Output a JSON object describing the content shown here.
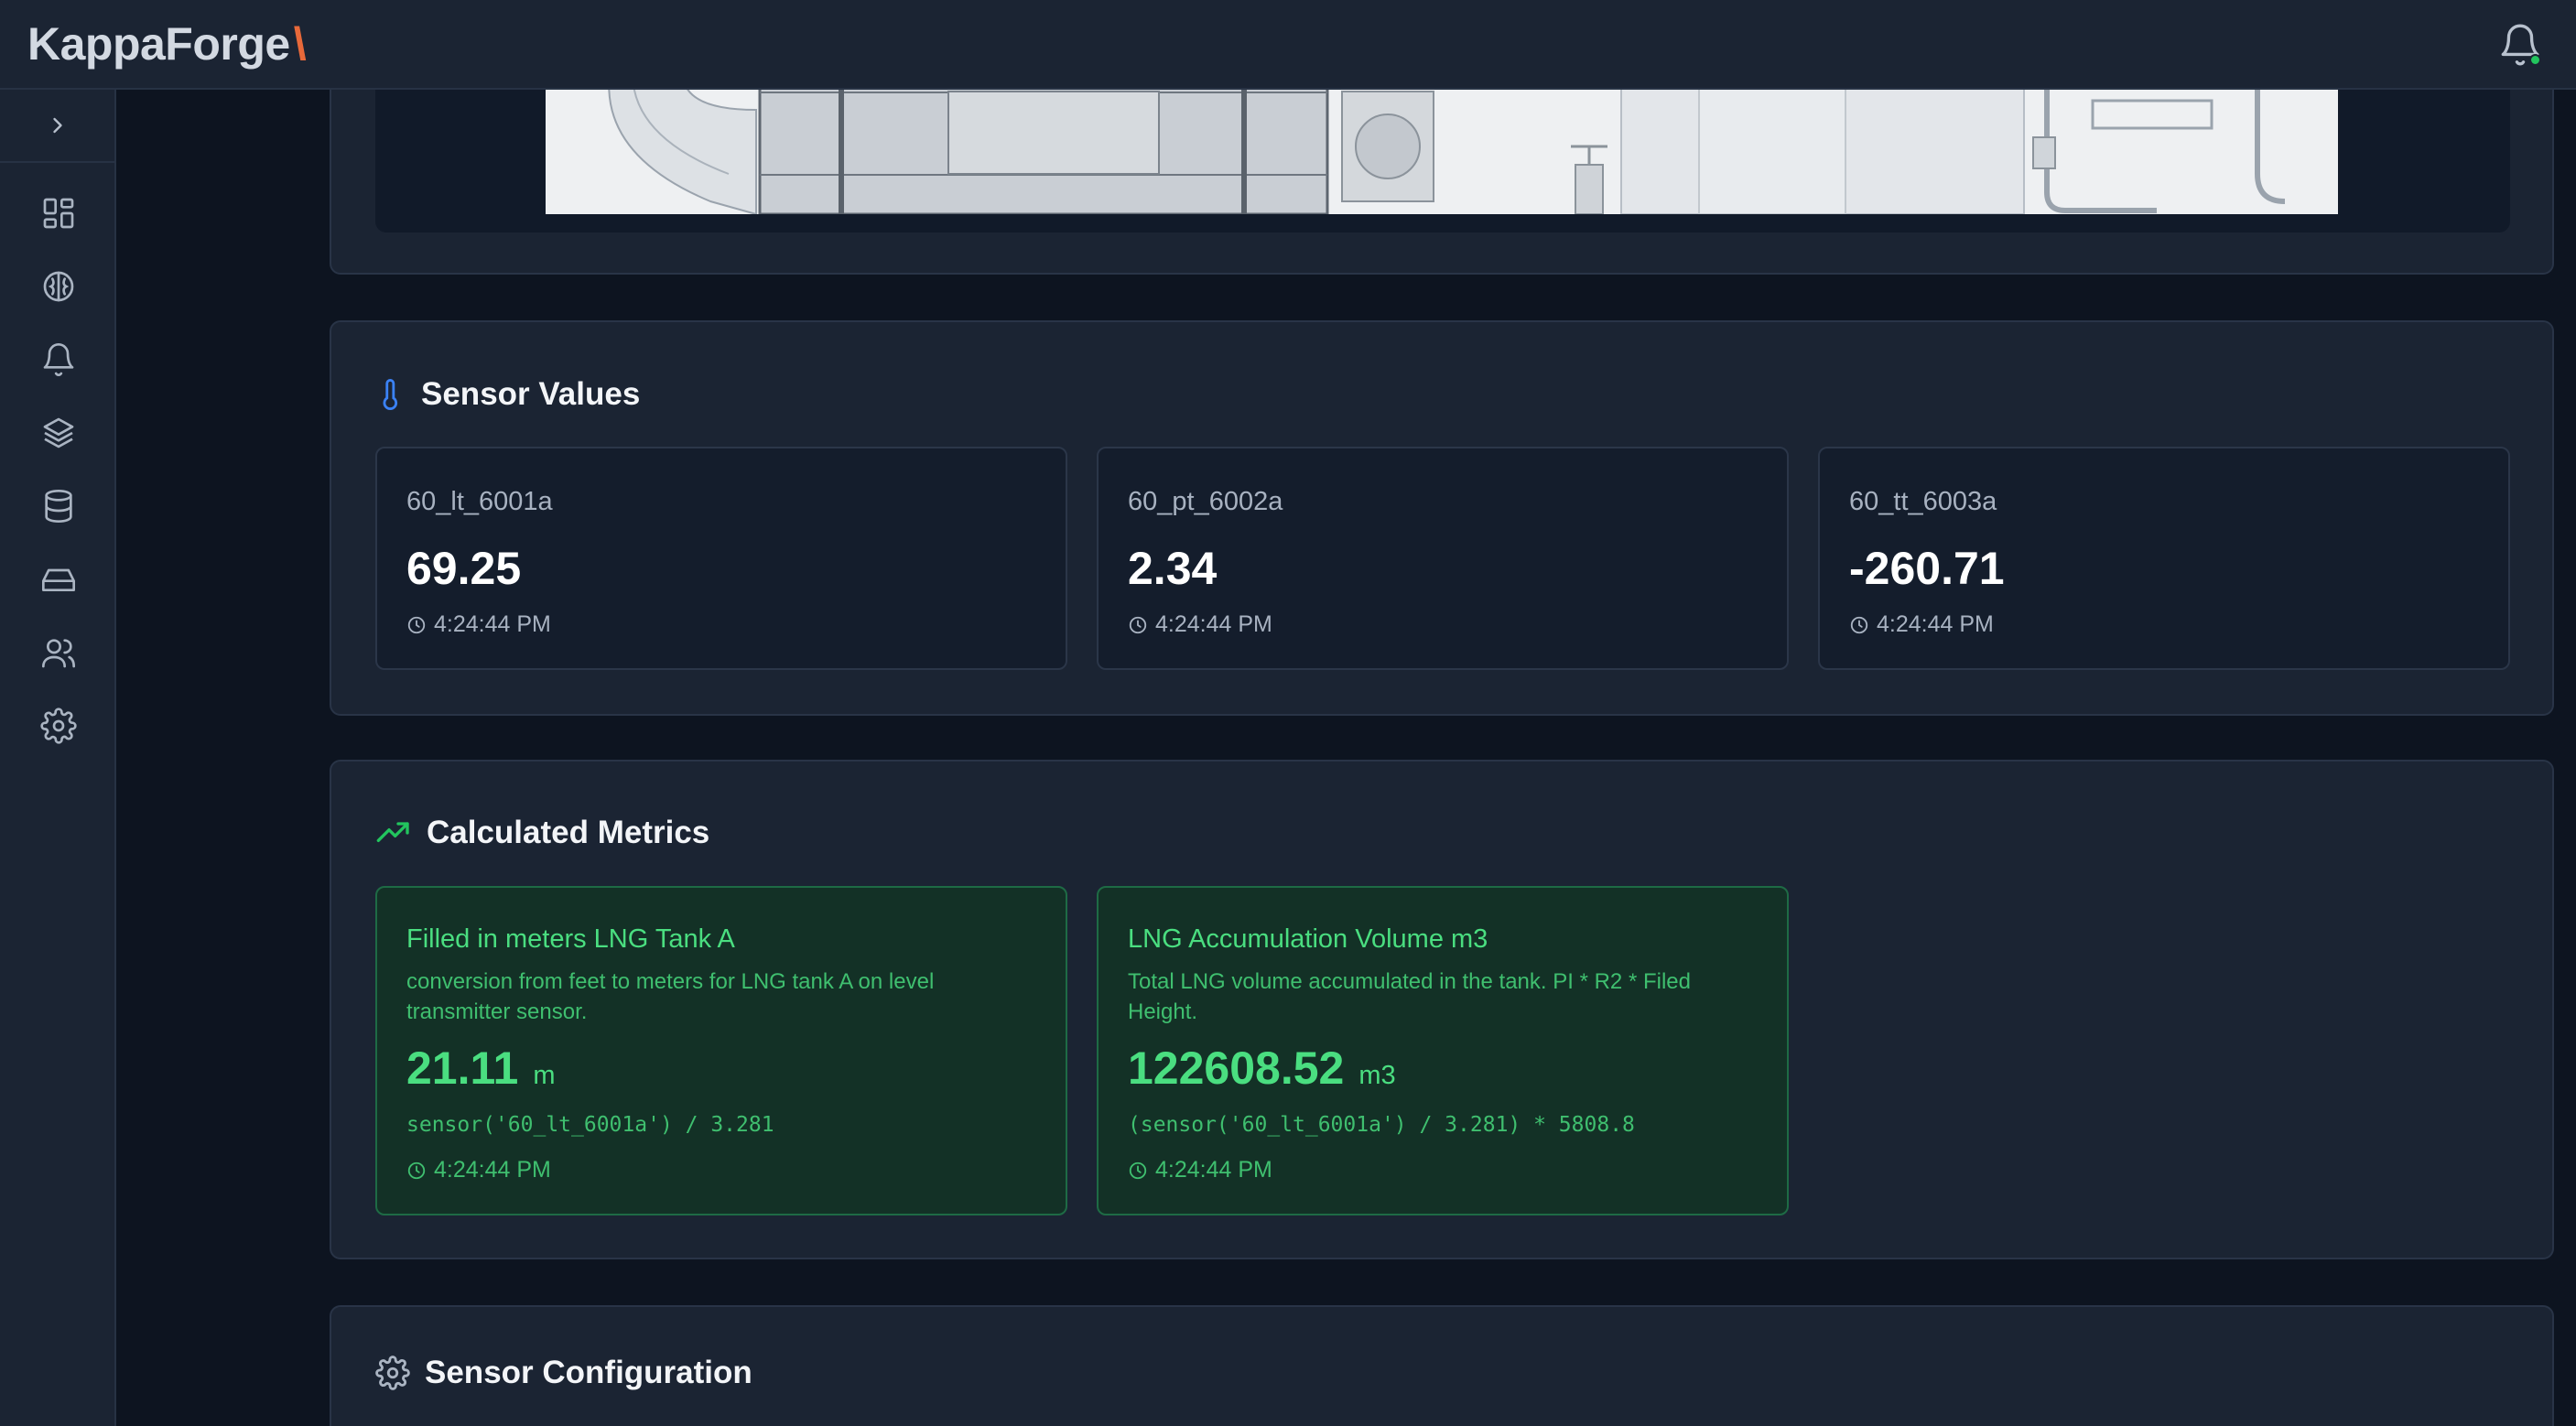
{
  "app": {
    "logo_text": "KappaForge",
    "logo_accent": "\\"
  },
  "header": {
    "notification_icon": "bell-icon",
    "has_notification": true
  },
  "sidebar": {
    "toggle_icon": "chevron-right-icon",
    "items": [
      {
        "icon": "dashboard-icon"
      },
      {
        "icon": "brain-icon"
      },
      {
        "icon": "bell-icon"
      },
      {
        "icon": "layers-icon"
      },
      {
        "icon": "database-icon"
      },
      {
        "icon": "hard-drive-icon"
      },
      {
        "icon": "users-icon"
      },
      {
        "icon": "settings-icon"
      }
    ]
  },
  "sensor_values": {
    "title": "Sensor Values",
    "items": [
      {
        "name": "60_lt_6001a",
        "value": "69.25",
        "time": "4:24:44 PM"
      },
      {
        "name": "60_pt_6002a",
        "value": "2.34",
        "time": "4:24:44 PM"
      },
      {
        "name": "60_tt_6003a",
        "value": "-260.71",
        "time": "4:24:44 PM"
      }
    ]
  },
  "calculated_metrics": {
    "title": "Calculated Metrics",
    "items": [
      {
        "name": "Filled in meters LNG Tank A",
        "description": "conversion from feet to meters for LNG tank A on level transmitter sensor.",
        "value": "21.11",
        "unit": "m",
        "formula": "sensor('60_lt_6001a') / 3.281",
        "time": "4:24:44 PM"
      },
      {
        "name": "LNG Accumulation Volume m3",
        "description": "Total LNG volume accumulated in the tank. PI * R2 * Filed Height.",
        "value": "122608.52",
        "unit": "m3",
        "formula": "(sensor('60_lt_6001a') / 3.281) * 5808.8",
        "time": "4:24:44 PM"
      }
    ]
  },
  "sensor_configuration": {
    "title": "Sensor Configuration"
  },
  "colors": {
    "accent": "#e8693a",
    "metric_green": "#4ade80",
    "background": "#0d1420",
    "card": "#1b2433"
  }
}
